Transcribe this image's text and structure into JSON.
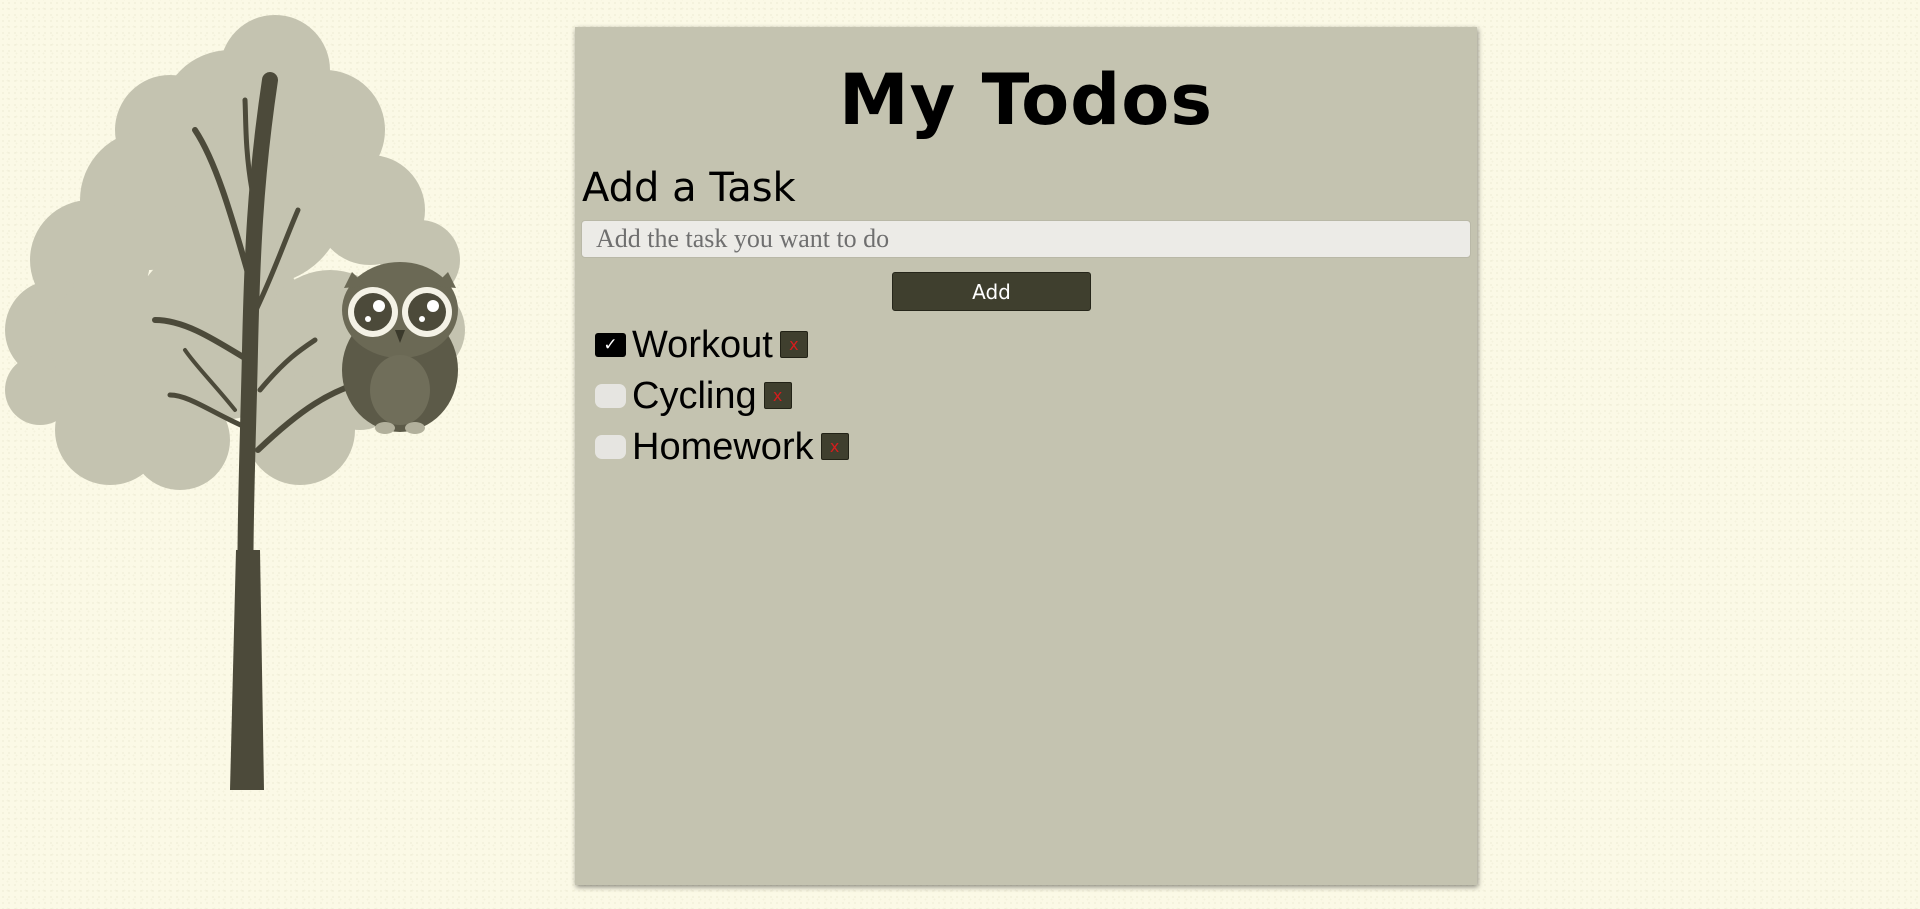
{
  "header": {
    "title": "My Todos"
  },
  "form": {
    "section_title": "Add a Task",
    "input_placeholder": "Add the task you want to do",
    "input_value": "",
    "add_label": "Add"
  },
  "todos": [
    {
      "label": "Workout",
      "checked": true
    },
    {
      "label": "Cycling",
      "checked": false
    },
    {
      "label": "Homework",
      "checked": false
    }
  ],
  "icons": {
    "checkmark": "checkmark-icon",
    "delete": "close-icon",
    "illustration": "tree-owl-illustration"
  },
  "colors": {
    "page_background": "#fbf9e6",
    "panel_background": "#c4c3b0",
    "button_background": "#3f3f2e",
    "delete_x": "#d41d1d",
    "foliage": "#c4c3b0",
    "trunk": "#4c4a3a"
  },
  "glyphs": {
    "check": "✓",
    "delete": "x"
  }
}
